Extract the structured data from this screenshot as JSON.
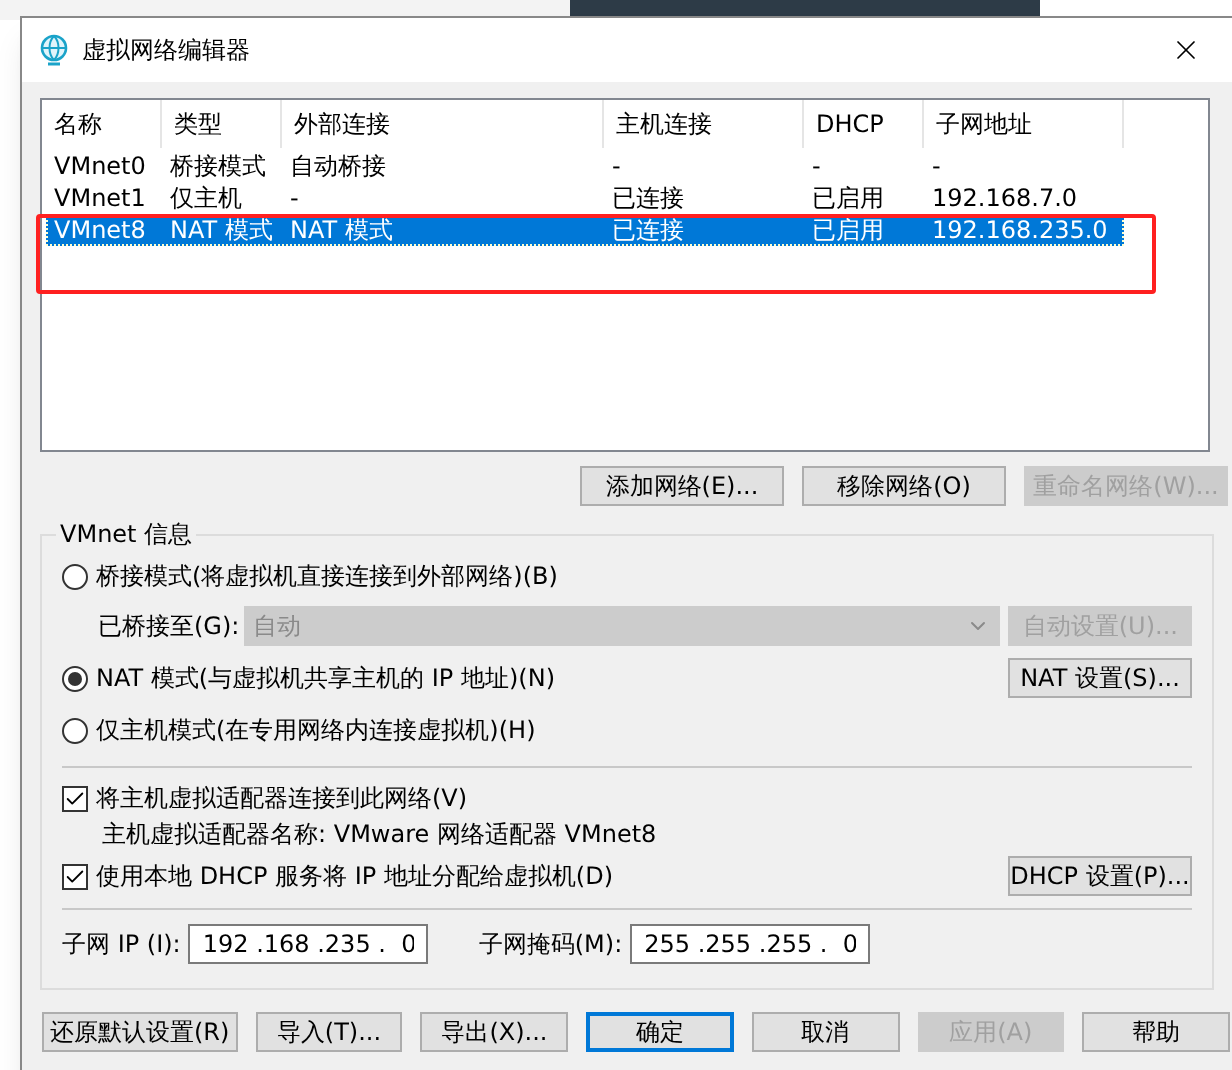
{
  "window": {
    "title": "虚拟网络编辑器"
  },
  "table": {
    "columns": [
      "名称",
      "类型",
      "外部连接",
      "主机连接",
      "DHCP",
      "子网地址"
    ],
    "rows": [
      {
        "cells": [
          "VMnet0",
          "桥接模式",
          "自动桥接",
          "-",
          "-",
          "-"
        ],
        "selected": false
      },
      {
        "cells": [
          "VMnet1",
          "仅主机",
          "-",
          "已连接",
          "已启用",
          "192.168.7.0"
        ],
        "selected": false
      },
      {
        "cells": [
          "VMnet8",
          "NAT 模式",
          "NAT 模式",
          "已连接",
          "已启用",
          "192.168.235.0"
        ],
        "selected": true
      }
    ]
  },
  "table_buttons": [
    {
      "label": "添加网络(E)...",
      "disabled": false
    },
    {
      "label": "移除网络(O)",
      "disabled": false
    },
    {
      "label": "重命名网络(W)...",
      "disabled": true
    }
  ],
  "group": {
    "title": "VMnet 信息",
    "modes": [
      {
        "label": "桥接模式(将虚拟机直接连接到外部网络)(B)",
        "selected": false
      },
      {
        "label": "NAT 模式(与虚拟机共享主机的 IP 地址)(N)",
        "selected": true,
        "button": {
          "label": "NAT 设置(S)...",
          "disabled": false
        }
      },
      {
        "label": "仅主机模式(在专用网络内连接虚拟机)(H)",
        "selected": false
      }
    ],
    "bridged_to": {
      "label": "已桥接至(G):",
      "value": "自动",
      "disabled": true,
      "button": {
        "label": "自动设置(U)...",
        "disabled": true
      }
    },
    "options": [
      {
        "label": "将主机虚拟适配器连接到此网络(V)",
        "checked": true,
        "note": "主机虚拟适配器名称: VMware 网络适配器 VMnet8"
      },
      {
        "label": "使用本地 DHCP 服务将 IP 地址分配给虚拟机(D)",
        "checked": true,
        "button": {
          "label": "DHCP 设置(P)...",
          "disabled": false
        }
      }
    ],
    "subnet_ip": {
      "label": "子网 IP (I):",
      "value": "192 .168 .235 .  0"
    },
    "subnet_mask": {
      "label": "子网掩码(M):",
      "value": "255 .255 .255 .  0"
    }
  },
  "footer_buttons": [
    {
      "label": "还原默认设置(R)",
      "disabled": false,
      "default": false
    },
    {
      "label": "导入(T)...",
      "disabled": false,
      "default": false
    },
    {
      "label": "导出(X)...",
      "disabled": false,
      "default": false
    },
    {
      "label": "确定",
      "disabled": false,
      "default": true
    },
    {
      "label": "取消",
      "disabled": false,
      "default": false
    },
    {
      "label": "应用(A)",
      "disabled": true,
      "default": false
    },
    {
      "label": "帮助",
      "disabled": false,
      "default": false
    }
  ]
}
